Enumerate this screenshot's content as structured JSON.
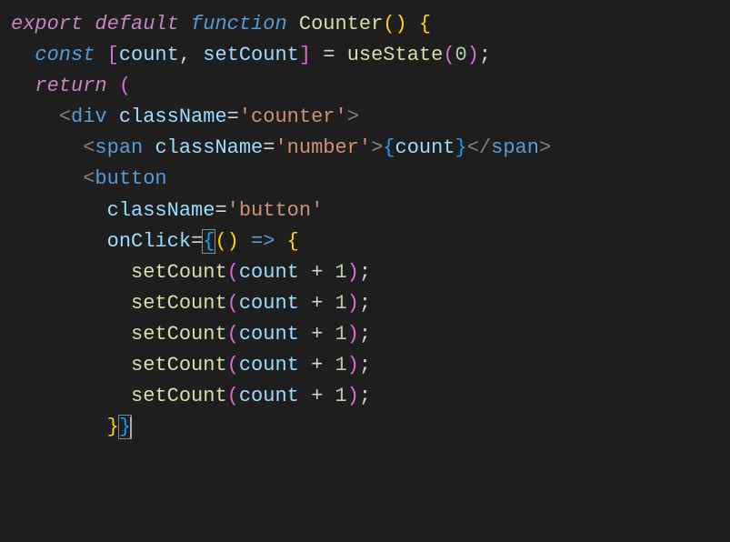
{
  "code": {
    "l1": {
      "export": "export",
      "default": "default",
      "function": "function",
      "name": "Counter",
      "paren_open": "(",
      "paren_close": ")",
      "brace_open": "{"
    },
    "l2": {
      "const": "const",
      "bracket_open": "[",
      "var1": "count",
      "comma": ",",
      "var2": "setCount",
      "bracket_close": "]",
      "eq": "=",
      "fn": "useState",
      "paren_open": "(",
      "arg": "0",
      "paren_close": ")",
      "semi": ";"
    },
    "l3": {
      "return": "return",
      "paren": "("
    },
    "l4": {
      "open": "<",
      "tag": "div",
      "attr": "className",
      "eq": "=",
      "val": "'counter'",
      "close": ">"
    },
    "l5": {
      "open": "<",
      "tag": "span",
      "attr": "className",
      "eq": "=",
      "val": "'number'",
      "close": ">",
      "expr_open": "{",
      "expr": "count",
      "expr_close": "}",
      "close_open": "</",
      "close_tag": "span",
      "close_close": ">"
    },
    "l6": {
      "open": "<",
      "tag": "button"
    },
    "l7": {
      "attr": "className",
      "eq": "=",
      "val": "'button'"
    },
    "l8": {
      "attr": "onClick",
      "eq": "=",
      "brace_open": "{",
      "paren_open": "(",
      "paren_close": ")",
      "arrow": "=>",
      "body_open": "{"
    },
    "l9_13": {
      "fn": "setCount",
      "paren_open": "(",
      "var": "count",
      "op": "+",
      "num": "1",
      "paren_close": ")",
      "semi": ";"
    },
    "l14": {
      "body_close": "}",
      "brace_close": "}"
    }
  }
}
